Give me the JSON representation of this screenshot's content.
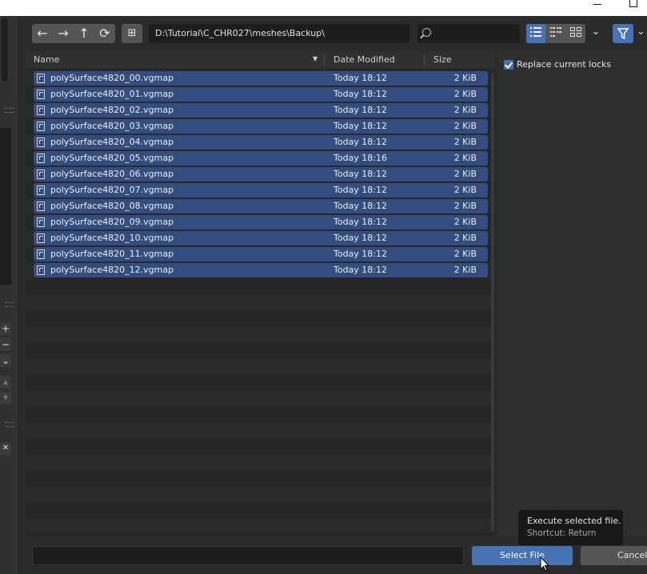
{
  "window": {
    "minimize_glyph": "",
    "maximize_glyph": ""
  },
  "toolbar": {
    "back_icon": "←",
    "forward_icon": "→",
    "parent_icon": "↑",
    "refresh_icon": "⟳",
    "new_folder_icon": "⊞",
    "path": "D:\\Tutorial\\C_CHR027\\meshes\\Backup\\",
    "search_placeholder": "",
    "view_chevron": "⌄"
  },
  "columns": {
    "name": "Name",
    "date": "Date Modified",
    "size": "Size",
    "sort_arrow": "▼"
  },
  "files": [
    {
      "name": "polySurface4820_00.vgmap",
      "date": "Today 18:12",
      "size": "2 KiB"
    },
    {
      "name": "polySurface4820_01.vgmap",
      "date": "Today 18:12",
      "size": "2 KiB"
    },
    {
      "name": "polySurface4820_02.vgmap",
      "date": "Today 18:12",
      "size": "2 KiB"
    },
    {
      "name": "polySurface4820_03.vgmap",
      "date": "Today 18:12",
      "size": "2 KiB"
    },
    {
      "name": "polySurface4820_04.vgmap",
      "date": "Today 18:12",
      "size": "2 KiB"
    },
    {
      "name": "polySurface4820_05.vgmap",
      "date": "Today 18:16",
      "size": "2 KiB"
    },
    {
      "name": "polySurface4820_06.vgmap",
      "date": "Today 18:12",
      "size": "2 KiB"
    },
    {
      "name": "polySurface4820_07.vgmap",
      "date": "Today 18:12",
      "size": "2 KiB"
    },
    {
      "name": "polySurface4820_08.vgmap",
      "date": "Today 18:12",
      "size": "2 KiB"
    },
    {
      "name": "polySurface4820_09.vgmap",
      "date": "Today 18:12",
      "size": "2 KiB"
    },
    {
      "name": "polySurface4820_10.vgmap",
      "date": "Today 18:12",
      "size": "2 KiB"
    },
    {
      "name": "polySurface4820_11.vgmap",
      "date": "Today 18:12",
      "size": "2 KiB"
    },
    {
      "name": "polySurface4820_12.vgmap",
      "date": "Today 18:12",
      "size": "2 KiB"
    }
  ],
  "options": {
    "replace_locks_label": "Replace current locks",
    "replace_locks_checked": true
  },
  "tooltip": {
    "title": "Execute selected file.",
    "shortcut": "Shortcut: Return"
  },
  "footer": {
    "filename_value": "",
    "select_label": "Select File",
    "cancel_label": "Cancel"
  },
  "leftstrip": {
    "plus": "+",
    "minus": "−",
    "chevron": "⌄",
    "up": "▲",
    "down": "▼",
    "close": "✕"
  },
  "colors": {
    "accent": "#4772b3",
    "selection": "#334d80",
    "background": "#2b2b2b"
  }
}
